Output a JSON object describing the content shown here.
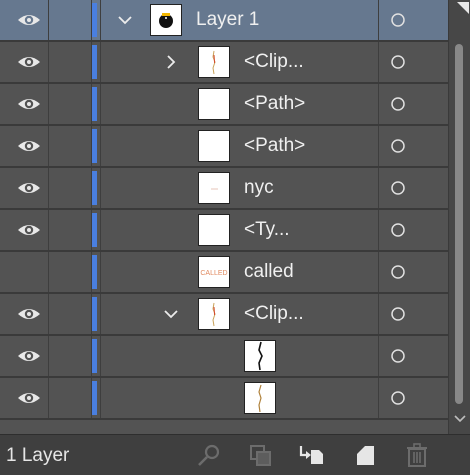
{
  "layers": [
    {
      "name": "Layer 1",
      "visible": true,
      "selected": true,
      "expander": "expanded",
      "indent": 0,
      "thumb": "layer-thumb",
      "has_selection_corner": true
    },
    {
      "name": "<Clip...",
      "visible": true,
      "selected": false,
      "expander": "collapsed",
      "indent": 1,
      "thumb": "clip-thumb"
    },
    {
      "name": "<Path>",
      "visible": true,
      "selected": false,
      "expander": "none",
      "indent": 1,
      "thumb": "blank-thumb"
    },
    {
      "name": "<Path>",
      "visible": true,
      "selected": false,
      "expander": "none",
      "indent": 1,
      "thumb": "blank-thumb"
    },
    {
      "name": "nyc",
      "visible": true,
      "selected": false,
      "expander": "none",
      "indent": 1,
      "thumb": "nyc-thumb"
    },
    {
      "name": "<Ty...",
      "visible": true,
      "selected": false,
      "expander": "none",
      "indent": 1,
      "thumb": "blank-thumb"
    },
    {
      "name": "called",
      "visible": false,
      "selected": false,
      "expander": "none",
      "indent": 1,
      "thumb": "called-thumb"
    },
    {
      "name": "<Clip...",
      "visible": true,
      "selected": false,
      "expander": "expanded",
      "indent": 1,
      "thumb": "clip-thumb"
    },
    {
      "name": "",
      "visible": true,
      "selected": false,
      "expander": "none",
      "indent": 2,
      "thumb": "crack-thumb"
    },
    {
      "name": "",
      "visible": true,
      "selected": false,
      "expander": "none",
      "indent": 2,
      "thumb": "crack2-thumb"
    }
  ],
  "thumb_text": {
    "called": "CALLED"
  },
  "footer": {
    "count_label": "1 Layer",
    "icons": [
      "locate-object-icon",
      "make-clipping-mask-icon",
      "create-sublayer-icon",
      "create-new-layer-icon",
      "delete-selection-icon"
    ]
  },
  "colors": {
    "panel_bg": "#535353",
    "selected_row": "#66788f",
    "layer_color": "#4a7fe0",
    "footer_bg": "#3f3f3f"
  }
}
